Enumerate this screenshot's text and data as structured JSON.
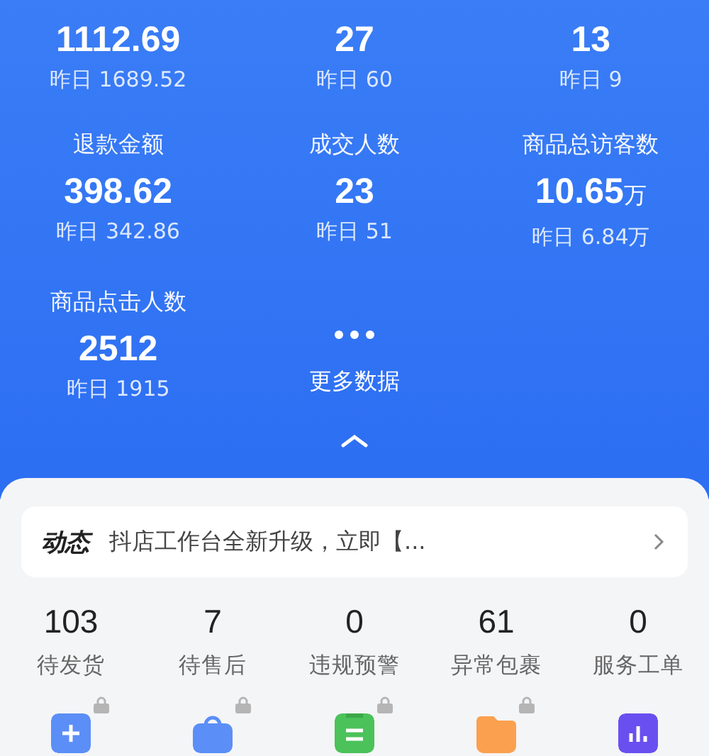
{
  "metrics": [
    {
      "value": "1112.69",
      "yesterday": "昨日 1689.52"
    },
    {
      "value": "27",
      "yesterday": "昨日 60"
    },
    {
      "value": "13",
      "yesterday": "昨日 9"
    },
    {
      "label": "退款金额",
      "value": "398.62",
      "yesterday": "昨日 342.86"
    },
    {
      "label": "成交人数",
      "value": "23",
      "yesterday": "昨日 51"
    },
    {
      "label": "商品总访客数",
      "value": "10.65",
      "unit": "万",
      "yesterday": "昨日 6.84万"
    },
    {
      "label": "商品点击人数",
      "value": "2512",
      "yesterday": "昨日 1915"
    }
  ],
  "more": {
    "label": "更多数据"
  },
  "news": {
    "tag": "动态",
    "text": "抖店工作台全新升级，立即【..."
  },
  "counts": [
    {
      "value": "103",
      "label": "待发货"
    },
    {
      "value": "7",
      "label": "待售后"
    },
    {
      "value": "0",
      "label": "违规预警"
    },
    {
      "value": "61",
      "label": "异常包裹"
    },
    {
      "value": "0",
      "label": "服务工单"
    }
  ],
  "tools": [
    {
      "kind": "plus",
      "color": "#5b8ef7",
      "locked": true
    },
    {
      "kind": "bag",
      "color": "#5b8ef7",
      "locked": true
    },
    {
      "kind": "clipboard",
      "color": "#4cc25a",
      "locked": true
    },
    {
      "kind": "folder",
      "color": "#fba04e",
      "locked": true
    },
    {
      "kind": "chart",
      "color": "#6a4ff0",
      "locked": false
    }
  ]
}
